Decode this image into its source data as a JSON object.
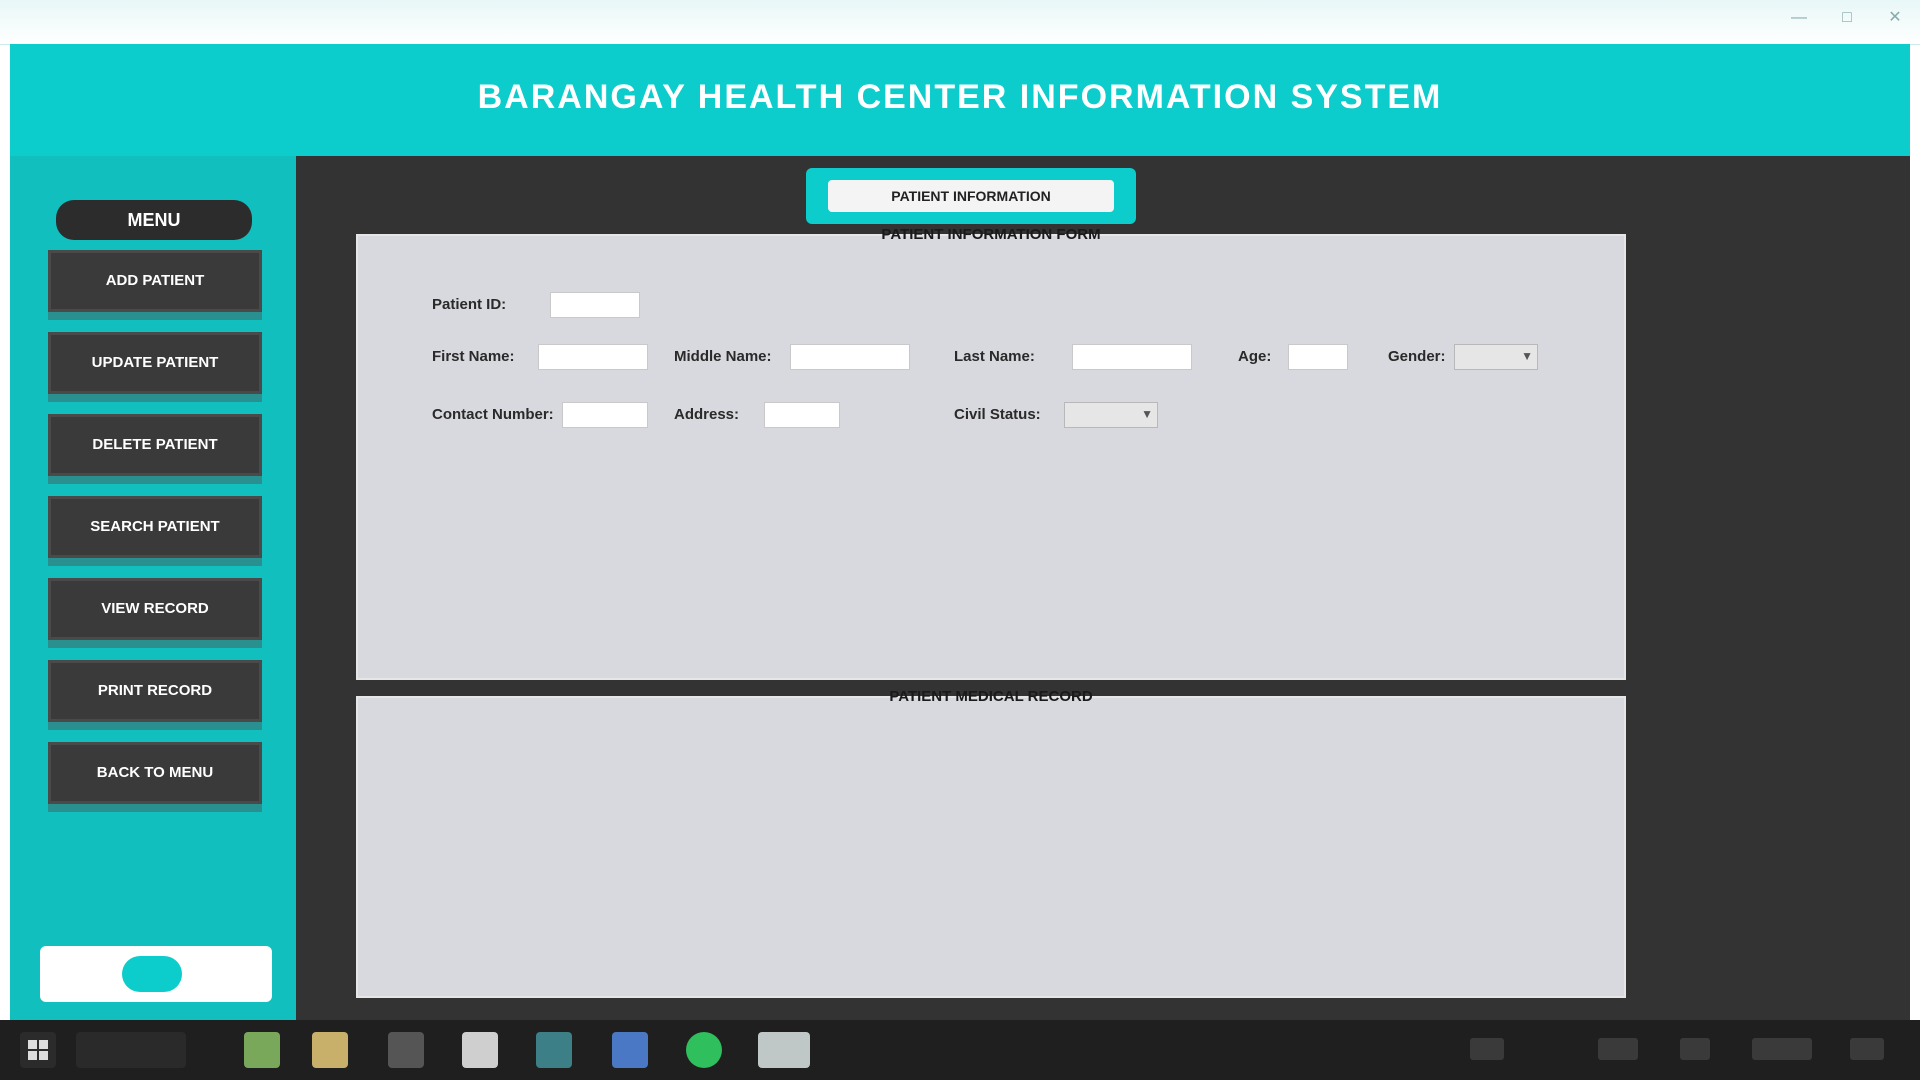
{
  "window": {
    "title": "",
    "sys_buttons": [
      "—",
      "□",
      "✕"
    ]
  },
  "header": {
    "title": "BARANGAY HEALTH CENTER INFORMATION SYSTEM"
  },
  "sidebar": {
    "menu_label": "MENU",
    "items": [
      {
        "label": "ADD PATIENT"
      },
      {
        "label": "UPDATE PATIENT"
      },
      {
        "label": "DELETE PATIENT"
      },
      {
        "label": "SEARCH PATIENT"
      },
      {
        "label": "VIEW RECORD"
      },
      {
        "label": "PRINT RECORD"
      },
      {
        "label": "BACK TO MENU"
      }
    ]
  },
  "content": {
    "tab_label": "PATIENT INFORMATION",
    "panel_top_title": "PATIENT INFORMATION FORM",
    "panel_bottom_title": "PATIENT MEDICAL RECORD",
    "fields": {
      "patient_id": {
        "label": "Patient ID:",
        "value": ""
      },
      "first_name": {
        "label": "First Name:",
        "value": ""
      },
      "middle_name": {
        "label": "Middle Name:",
        "value": ""
      },
      "last_name": {
        "label": "Last Name:",
        "value": ""
      },
      "age": {
        "label": "Age:",
        "value": ""
      },
      "gender": {
        "label": "Gender:",
        "value": ""
      },
      "contact_number": {
        "label": "Contact Number:",
        "value": ""
      },
      "address": {
        "label": "Address:",
        "value": ""
      },
      "civil_status": {
        "label": "Civil Status:",
        "value": ""
      }
    }
  },
  "taskbar": {
    "icons": [
      "start-icon",
      "search-icon",
      "task-view-icon",
      "file-explorer-icon",
      "folder-icon",
      "store-icon",
      "browser-icon",
      "netbeans-icon",
      "spotify-icon",
      "app-window-icon"
    ]
  },
  "colors": {
    "accent": "#0ccccc",
    "dark": "#333333",
    "panel": "#d8d9de"
  }
}
